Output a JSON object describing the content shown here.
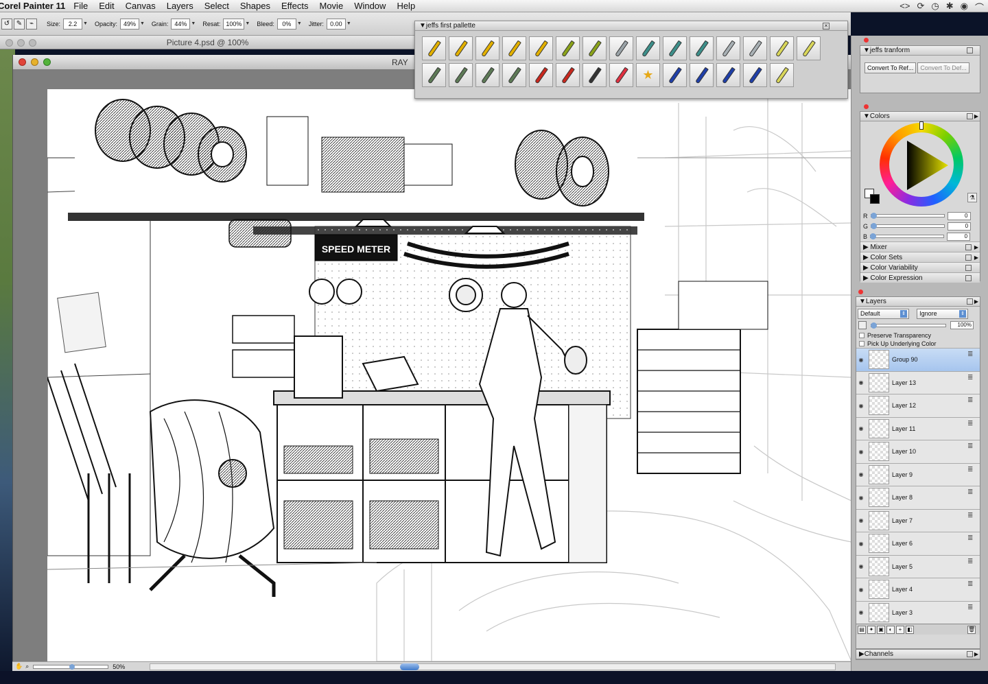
{
  "menubar": {
    "app_name": "Corel Painter 11",
    "items": [
      "File",
      "Edit",
      "Canvas",
      "Layers",
      "Select",
      "Shapes",
      "Effects",
      "Movie",
      "Window",
      "Help"
    ],
    "status_icons": [
      "<>",
      "⟳",
      "◷",
      "✱",
      "◉",
      "⌒"
    ]
  },
  "propbar": {
    "size_label": "Size:",
    "size": "2.2",
    "opacity_label": "Opacity:",
    "opacity": "49%",
    "grain_label": "Grain:",
    "grain": "44%",
    "resat_label": "Resat:",
    "resat": "100%",
    "bleed_label": "Bleed:",
    "bleed": "0%",
    "jitter_label": "Jitter:",
    "jitter": "0.00"
  },
  "background_doc": {
    "title": "Picture 4.psd @ 100%"
  },
  "document": {
    "title": "RAY"
  },
  "canvas": {
    "sign_text": "SPEED METER"
  },
  "statusbar": {
    "zoom": "50%"
  },
  "palette": {
    "title": "jeffs first pallette",
    "brushes": [
      {
        "icon": "pencil-yellow-icon",
        "color": "#e2b000"
      },
      {
        "icon": "pencil-yellow-icon",
        "color": "#e2b000"
      },
      {
        "icon": "pencil-yellow-icon",
        "color": "#e2b000"
      },
      {
        "icon": "pencil-yellow-icon",
        "color": "#e2b000"
      },
      {
        "icon": "pencil-yellow-icon",
        "color": "#e2b000"
      },
      {
        "icon": "pencil-green-icon",
        "color": "#8aa21a"
      },
      {
        "icon": "pencil-green-icon",
        "color": "#8aa21a"
      },
      {
        "icon": "pen-gray-icon",
        "color": "#9aa3a8"
      },
      {
        "icon": "pen-teal-icon",
        "color": "#3d8f8a"
      },
      {
        "icon": "pen-teal-icon",
        "color": "#3d8f8a"
      },
      {
        "icon": "pen-teal-icon",
        "color": "#3d8f8a"
      },
      {
        "icon": "pen-gray-icon",
        "color": "#a8b0b4"
      },
      {
        "icon": "pen-gray-icon",
        "color": "#a8b0b4"
      },
      {
        "icon": "pencil-pale-icon",
        "color": "#d9d65a"
      },
      {
        "icon": "pencil-pale-icon",
        "color": "#d9d65a"
      },
      {
        "icon": "eraser-green-icon",
        "color": "#5d7a56"
      },
      {
        "icon": "eraser-green-icon",
        "color": "#5d7a56"
      },
      {
        "icon": "eraser-green-icon",
        "color": "#5d7a56"
      },
      {
        "icon": "eraser-green-icon",
        "color": "#5d7a56"
      },
      {
        "icon": "pencil-red-icon",
        "color": "#c8281e"
      },
      {
        "icon": "pencil-red-icon",
        "color": "#c8281e"
      },
      {
        "icon": "chalk-dark-icon",
        "color": "#333333"
      },
      {
        "icon": "eraser-red-icon",
        "color": "#e03040"
      },
      {
        "icon": "star-icon",
        "color": "#e6a817"
      },
      {
        "icon": "ink-blue-icon",
        "color": "#1f3fa8"
      },
      {
        "icon": "ink-blue-icon",
        "color": "#1f3fa8"
      },
      {
        "icon": "ink-blue-icon",
        "color": "#1f3fa8"
      },
      {
        "icon": "ink-blue-icon",
        "color": "#1f3fa8"
      },
      {
        "icon": "pencil-pale-icon",
        "color": "#d9d65a"
      }
    ]
  },
  "transform_panel": {
    "title": "jeffs tranform",
    "btn1": "Convert To Ref...",
    "btn2": "Convert To Def..."
  },
  "colors_panel": {
    "title": "Colors",
    "r_label": "R",
    "g_label": "G",
    "b_label": "B",
    "r": "0",
    "g": "0",
    "b": "0"
  },
  "collapsed_panels": [
    "Mixer",
    "Color Sets",
    "Color Variability",
    "Color Expression"
  ],
  "layers_panel": {
    "title": "Layers",
    "composite_method": "Default",
    "composite_depth": "Ignore",
    "opacity": "100%",
    "preserve_transparency": "Preserve Transparency",
    "pick_up_color": "Pick Up Underlying Color",
    "layers": [
      {
        "name": "Group 90",
        "selected": true
      },
      {
        "name": "Layer 13"
      },
      {
        "name": "Layer 12"
      },
      {
        "name": "Layer 11"
      },
      {
        "name": "Layer 10"
      },
      {
        "name": "Layer 9"
      },
      {
        "name": "Layer 8"
      },
      {
        "name": "Layer 7"
      },
      {
        "name": "Layer 6"
      },
      {
        "name": "Layer 5"
      },
      {
        "name": "Layer 4"
      },
      {
        "name": "Layer 3"
      }
    ]
  },
  "channels_panel": {
    "title": "Channels"
  }
}
